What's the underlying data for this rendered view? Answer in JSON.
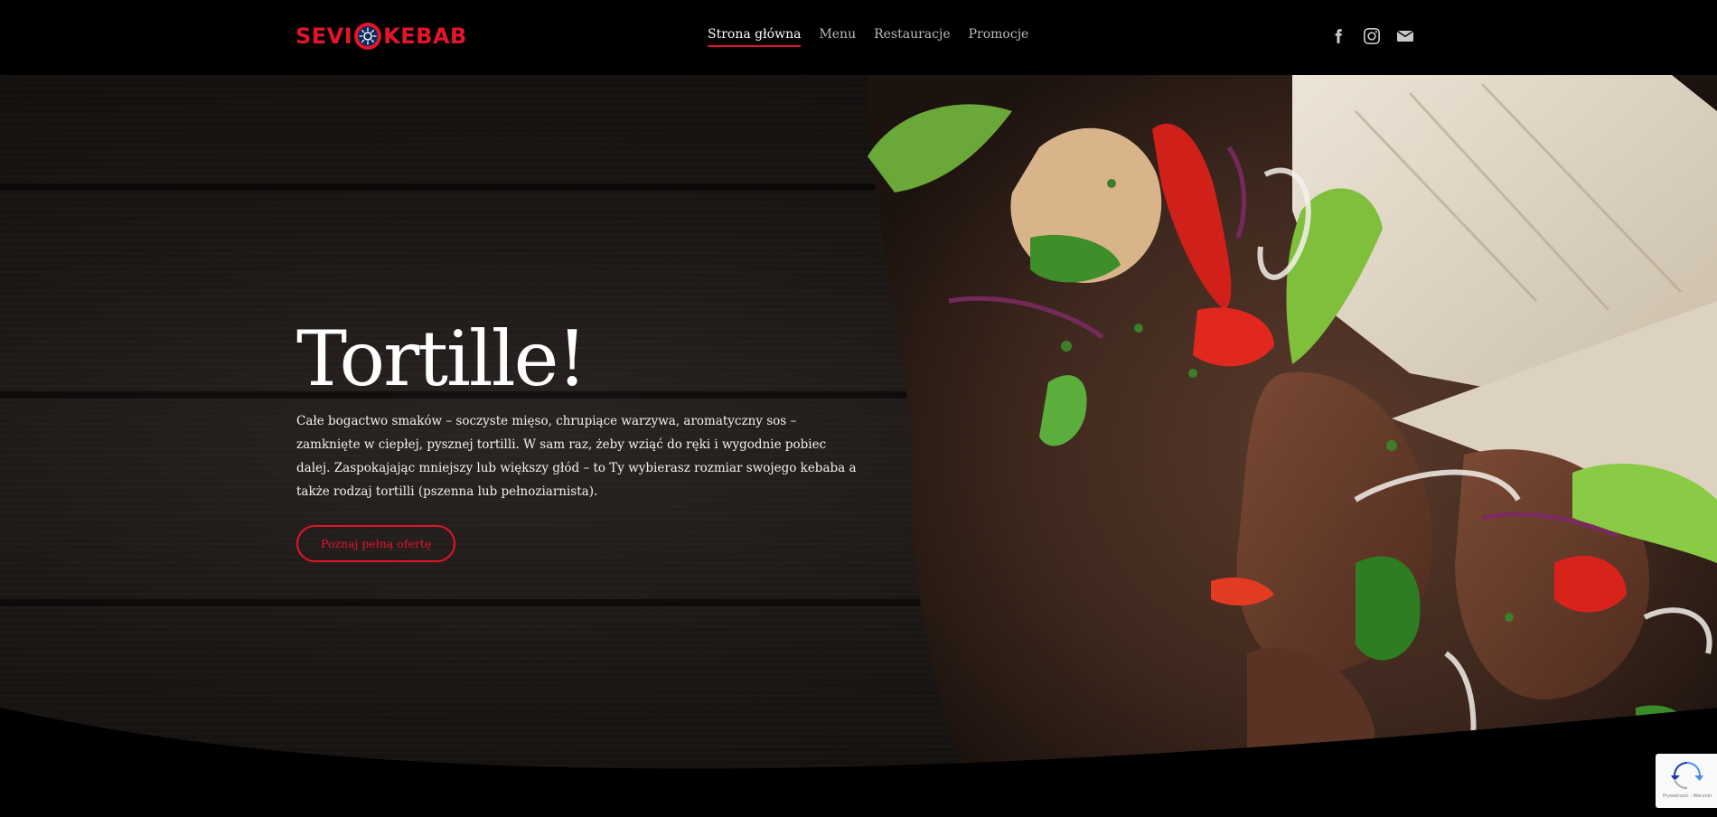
{
  "header": {
    "logo": {
      "left": "SEVI",
      "right": "KEBAB"
    },
    "nav": [
      {
        "label": "Strona główna",
        "active": true
      },
      {
        "label": "Menu",
        "active": false
      },
      {
        "label": "Restauracje",
        "active": false
      },
      {
        "label": "Promocje",
        "active": false
      }
    ],
    "socials": [
      "facebook-icon",
      "instagram-icon",
      "envelope-icon"
    ]
  },
  "hero": {
    "title": "Tortille!",
    "description": "Całe bogactwo smaków – soczyste mięso, chrupiące warzywa, aromatyczny sos – zamknięte w ciepłej, pysznej tortilli. W sam raz, żeby wziąć do ręki i wygodnie pobiec dalej. Zaspokajając mniejszy lub większy głód – to Ty wybierasz rozmiar swojego kebaba a także rodzaj tortilli (pszenna lub pełnoziarnista).",
    "button_label": "Poznaj pełną ofertę"
  },
  "recaptcha": {
    "text": "Prywatność - Warunki"
  },
  "colors": {
    "accent": "#e3152a",
    "background": "#000000"
  }
}
